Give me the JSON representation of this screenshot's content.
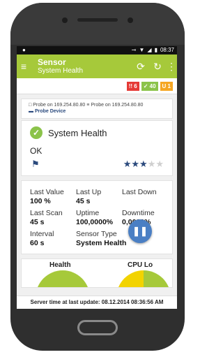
{
  "status_bar": {
    "time": "08:37"
  },
  "app_bar": {
    "title": "Sensor",
    "subtitle": "System Health"
  },
  "badges": [
    {
      "text": "!! 6",
      "color": "#e53935"
    },
    {
      "text": "✓ 40",
      "color": "#8bc34a"
    },
    {
      "text": "U 1",
      "color": "#f5a623"
    }
  ],
  "breadcrumb": {
    "probe1": "Probe on 169.254.80.80",
    "probe2": "Probe on 169.254.80.80",
    "device": "Probe Device"
  },
  "sensor": {
    "name": "System Health",
    "status": "OK",
    "priority_stars": 3,
    "priority_max": 5
  },
  "stats": [
    {
      "label": "Last Value",
      "value": "100 %"
    },
    {
      "label": "Last Up",
      "value": "45 s"
    },
    {
      "label": "Last Down",
      "value": ""
    },
    {
      "label": "Last Scan",
      "value": "45 s"
    },
    {
      "label": "Uptime",
      "value": "100,0000%"
    },
    {
      "label": "Downtime",
      "value": "0,0000%"
    },
    {
      "label": "Interval",
      "value": "60 s"
    },
    {
      "label": "Sensor Type",
      "value": "System Health"
    },
    {
      "label": "",
      "value": ""
    }
  ],
  "gauges": {
    "left_label": "Health",
    "right_label": "CPU Lo"
  },
  "footer": {
    "text": "Server time at last update: 08.12.2014 08:36:56 AM"
  },
  "colors": {
    "accent": "#a6c93a",
    "navy": "#2b4a7d",
    "fab": "#4a7fc4"
  }
}
